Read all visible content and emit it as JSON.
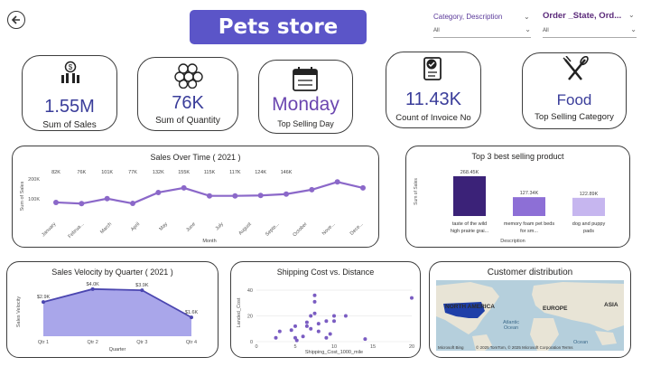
{
  "header": {
    "title": "Pets store"
  },
  "slicers": [
    {
      "label": "Category, Description",
      "value": "All"
    },
    {
      "label": "Order _State, Ord...",
      "value": "All"
    }
  ],
  "kpis": [
    {
      "value": "1.55M",
      "label": "Sum of Sales",
      "icon": "money-chart-icon"
    },
    {
      "value": "76K",
      "label": "Sum of Quantity",
      "icon": "stack-icon"
    },
    {
      "value": "Monday",
      "label": "Top Selling Day",
      "icon": "calendar-icon"
    },
    {
      "value": "11.43K",
      "label": "Count of Invoice No",
      "icon": "invoice-icon"
    },
    {
      "value": "Food",
      "label": "Top Selling Category",
      "icon": "fork-knife-icon"
    }
  ],
  "colors": {
    "accent": "#5b55c8",
    "line": "#8b68c9",
    "kpi_value": "#3a3d9a",
    "bar1": "#3b2278",
    "bar2": "#8d6fd6",
    "bar3": "#c6b6ef",
    "area": "#a9a6ea"
  },
  "chart_data": [
    {
      "type": "line",
      "title": "Sales Over Time ( 2021 )",
      "xlabel": "Month",
      "ylabel": "Sum of Sales",
      "yticks": [
        "200K",
        "100K"
      ],
      "ylim": [
        0,
        250
      ],
      "categories": [
        "January",
        "Februa...",
        "March",
        "April",
        "May",
        "June",
        "July",
        "August",
        "Septe...",
        "October",
        "Nove...",
        "Dece..."
      ],
      "values": [
        82,
        76,
        101,
        77,
        132,
        155,
        115,
        115,
        117,
        124,
        146,
        185,
        155
      ],
      "labels": [
        "82K",
        "76K",
        "101K",
        "77K",
        "132K",
        "155K",
        "115K",
        "117K",
        "124K",
        "146K"
      ]
    },
    {
      "type": "bar",
      "title": "Top 3 best selling product",
      "xlabel": "Description",
      "ylabel": "Sum of Sales",
      "categories": [
        "taste of the wild high prairie grai...",
        "memory foam pet beds for sm...",
        "dog and puppy pads"
      ],
      "values": [
        268.45,
        127.34,
        122.89
      ],
      "labels": [
        "268.45K",
        "127.34K",
        "122.89K"
      ]
    },
    {
      "type": "area",
      "title": "Sales Velocity by Quarter ( 2021 )",
      "xlabel": "Quarter",
      "ylabel": "Sales Velocity",
      "categories": [
        "Qtr 1",
        "Qtr 2",
        "Qtr 3",
        "Qtr 4"
      ],
      "values": [
        2.9,
        4.0,
        3.9,
        1.6
      ],
      "labels": [
        "$2.9K",
        "$4.0K",
        "$3.9K",
        "$1.6K"
      ],
      "ylim": [
        0,
        4.6
      ]
    },
    {
      "type": "scatter",
      "title": "Shipping Cost vs. Distance",
      "xlabel": "Shipping_Cost_1000_mile",
      "ylabel": "Landed_Cost",
      "xticks": [
        "0",
        "5",
        "10",
        "15",
        "20"
      ],
      "yticks": [
        "40",
        "20",
        "0"
      ],
      "xlim": [
        0,
        20
      ],
      "ylim": [
        0,
        45
      ],
      "points": [
        [
          2.5,
          3
        ],
        [
          3,
          8
        ],
        [
          4.5,
          9
        ],
        [
          5,
          12
        ],
        [
          5,
          3
        ],
        [
          5.2,
          1
        ],
        [
          6,
          4
        ],
        [
          6.5,
          12
        ],
        [
          6.5,
          15
        ],
        [
          7,
          10
        ],
        [
          7,
          20
        ],
        [
          7.5,
          22
        ],
        [
          7.5,
          36
        ],
        [
          7.5,
          31
        ],
        [
          8,
          8
        ],
        [
          8,
          14
        ],
        [
          9,
          3
        ],
        [
          9,
          16
        ],
        [
          9.5,
          6
        ],
        [
          10,
          20
        ],
        [
          10,
          16
        ],
        [
          11.5,
          20
        ],
        [
          14,
          2
        ],
        [
          20,
          34
        ]
      ]
    }
  ],
  "map": {
    "title": "Customer distribution",
    "labels": {
      "north_america": "NORTH AMERICA",
      "europe": "EUROPE",
      "asia": "ASIA",
      "atlantic": "Atlantic\nOcean",
      "ocean2": "Ocean"
    },
    "footer_left": "Microsoft Bing",
    "footer_right": "© 2025 TomTom, © 2025 Microsoft Corporation  Terms"
  }
}
